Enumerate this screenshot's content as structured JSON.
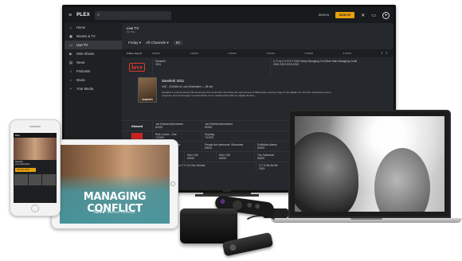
{
  "tv": {
    "app_name": "PLEX",
    "search_icon": "search-icon",
    "menu_icon": "hamburger-menu-icon",
    "sign_in": "SIGN IN",
    "sign_up": "SIGN UP",
    "brand": "SONY",
    "sidebar": [
      {
        "label": "Home",
        "icon": "home-icon"
      },
      {
        "label": "Movies & TV",
        "icon": "film-icon"
      },
      {
        "label": "Live TV",
        "icon": "tv-icon"
      },
      {
        "label": "Web Shows",
        "icon": "play-icon"
      },
      {
        "label": "News",
        "icon": "news-icon"
      },
      {
        "label": "Podcasts",
        "icon": "mic-icon"
      },
      {
        "label": "Music",
        "icon": "music-icon"
      },
      {
        "label": "Your Media",
        "icon": "plus-icon"
      }
    ],
    "header": {
      "title": "Live TV",
      "subtitle": "On Plex"
    },
    "filters": {
      "day": "Friday ▾",
      "channels": "All Channels ▾",
      "count": "64"
    },
    "timebar": {
      "day": "Friday, Aug 16",
      "times": [
        "4:00AM",
        "4:30AM",
        "5:00AM",
        "5:30AM",
        "6:00AM",
        "6:30AM"
      ]
    },
    "channel_logo": "love",
    "row1": {
      "show": "Sanskriti",
      "year": "2011",
      "right": "C O  ns  2 U  R  9  2 2010  Many  Managing Conf  Man  Man  Managing Confli"
    },
    "row1_years": "2019  2019  2018  2019",
    "detail": {
      "poster_text": "SANSKRITI",
      "title": "Sanskriti  2011",
      "time": "4:00 – 5:00AM on Love Destination — 58 min",
      "description": "Sanskriti is a documentary filmed around the world that chronicles the experiences of Millennials coming of age in the digital era. The film celebrates human progress, and encourages re-examination of our relationships with our digital devices."
    },
    "row2": {
      "logo": "Glowed",
      "cells": [
        [
          "Joe Robinet Adventures",
          "8/3/20"
        ],
        [
          "Joe Robinet Adventures",
          "8/3/20"
        ]
      ]
    },
    "row3": {
      "cells": [
        [
          "Rick Londro - One",
          "7/13/20"
        ],
        [
          "Sophing",
          "7/13/20"
        ]
      ]
    },
    "row4": {
      "logo": "BG",
      "cells": [
        [
          "Awesome: Showcase",
          "8/5/20"
        ],
        [
          "People Are Awesome: Showcase",
          "8/5/20"
        ],
        [
          "Exhibition Aweso",
          "8/5/20"
        ]
      ]
    },
    "row5": {
      "cells": [
        [
          "Todd World",
          "8/9/20"
        ],
        [
          "Hero 108",
          "8/9/20"
        ],
        [
          "Hero 108",
          "8/9/20"
        ],
        [
          "The Solutioner",
          "8/8/20"
        ]
      ]
    },
    "row6": {
      "cells": [
        [
          "T C Bu Bi Bi Bi Bu Bul T C On Yom Stories",
          "2019 2018 2019"
        ],
        [
          "C C B Be Bd Be",
          "2019"
        ]
      ]
    }
  },
  "tablet": {
    "title": "MANAGING CONFLICT",
    "footer_logo": "love",
    "footer_text": "ONLINE COURSE"
  },
  "phone": {
    "title": "Plex",
    "lines": [
      "Sanskriti",
      "Love Destination"
    ],
    "button": "WATCH NOW"
  },
  "devices": {
    "apple_logo": "",
    "remote_brand": "roku"
  }
}
